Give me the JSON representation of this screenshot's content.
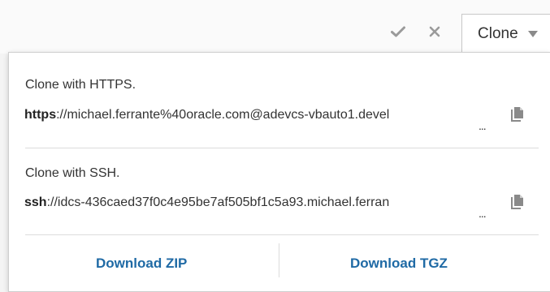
{
  "toolbar": {
    "confirm_icon": "checkmark-icon",
    "cancel_icon": "close-icon",
    "clone_label": "Clone",
    "clone_caret_icon": "caret-down-icon"
  },
  "panel": {
    "https": {
      "title": "Clone with HTTPS.",
      "protocol": "https",
      "rest": "://michael.ferrante%40oracle.com@adevcs-vbauto1.devel",
      "ellipsis": "...",
      "copy_icon": "copy-icon"
    },
    "ssh": {
      "title": "Clone with SSH.",
      "protocol": "ssh",
      "rest": "://idcs-436caed37f0c4e95be7af505bf1c5a93.michael.ferran",
      "ellipsis": "...",
      "copy_icon": "copy-icon"
    },
    "download_zip": "Download ZIP",
    "download_tgz": "Download TGZ"
  },
  "colors": {
    "link": "#1f6aa5",
    "text": "#333333",
    "icon": "#8a8a8a"
  }
}
